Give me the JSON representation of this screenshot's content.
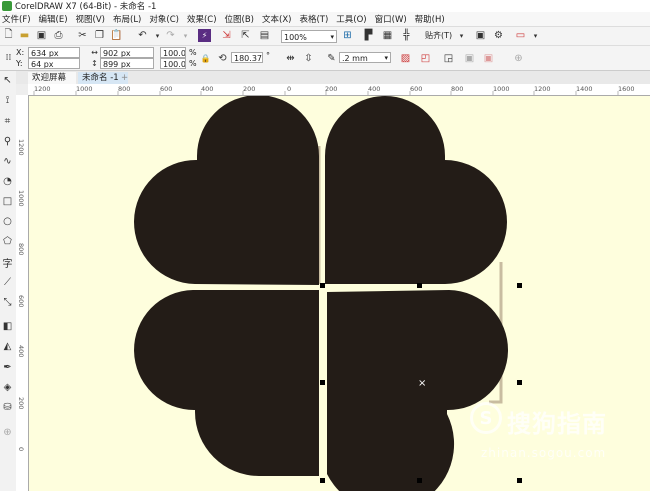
{
  "window": {
    "title": "CorelDRAW X7 (64-Bit) - 未命名 -1"
  },
  "menu": [
    "文件(F)",
    "编辑(E)",
    "视图(V)",
    "布局(L)",
    "对象(C)",
    "效果(C)",
    "位图(B)",
    "文本(X)",
    "表格(T)",
    "工具(O)",
    "窗口(W)",
    "帮助(H)"
  ],
  "toolbar": {
    "zoom": "100%",
    "snap_label": "贴齐(T)"
  },
  "propbar": {
    "x_label": "X:",
    "x": "634 px",
    "y_label": "Y:",
    "y": "64 px",
    "w": "902 px",
    "h": "899 px",
    "scale_w": "100.0",
    "scale_h": "100.0",
    "pct": "%",
    "rotation": "180.377",
    "deg": "°",
    "outline": ".2 mm"
  },
  "tabs": {
    "welcome": "欢迎屏幕",
    "doc": "未命名 -1",
    "add": "+"
  },
  "ruler": {
    "h": [
      "1200",
      "1000",
      "800",
      "600",
      "400",
      "200",
      "0",
      "200",
      "400",
      "600",
      "800",
      "1000",
      "1200",
      "1400",
      "1600"
    ],
    "v": [
      "1200",
      "1000",
      "800",
      "600",
      "400",
      "200",
      "0"
    ]
  },
  "watermark": {
    "brand": "搜狗指南",
    "url": "zhinan.sogou.com"
  },
  "colors": {
    "shape": "#231c17",
    "canvas": "#fefedd"
  }
}
